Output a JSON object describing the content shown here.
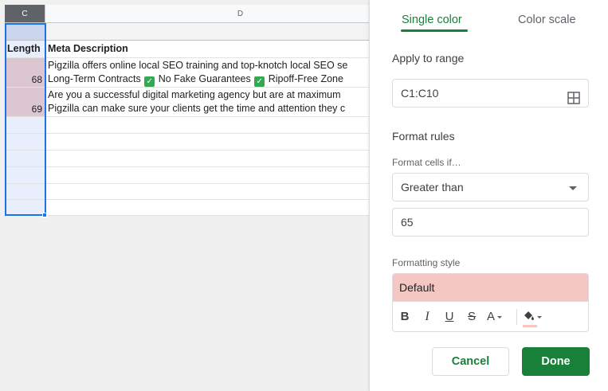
{
  "sheet": {
    "col_c": "C",
    "col_d": "D",
    "header_length": "Length",
    "header_meta": "Meta Description",
    "rows": [
      {
        "length": "68",
        "line1": "Pigzilla offers online local SEO training and top-knotch local SEO se",
        "line2_a": "Long-Term Contracts",
        "line2_b": "No Fake Guarantees",
        "line2_c": "Ripoff-Free Zone"
      },
      {
        "length": "69",
        "line1": "Are you a successful digital marketing agency but are at maximum",
        "line2": "Pigzilla can make sure your clients get the time and attention they c"
      }
    ]
  },
  "panel": {
    "tabs": {
      "single": "Single color",
      "scale": "Color scale"
    },
    "apply_label": "Apply to range",
    "range_value": "C1:C10",
    "format_rules": "Format rules",
    "format_cells_if": "Format cells if…",
    "condition": "Greater than",
    "value": "65",
    "formatting_style": "Formatting style",
    "style_preview": "Default",
    "toolbar": {
      "bold": "B",
      "italic": "I",
      "underline": "U",
      "strike": "S",
      "text_color": "A"
    },
    "cancel": "Cancel",
    "done": "Done"
  },
  "colors": {
    "accent": "#188038",
    "highlight": "#f4c7c3",
    "selection": "#1a73e8"
  }
}
